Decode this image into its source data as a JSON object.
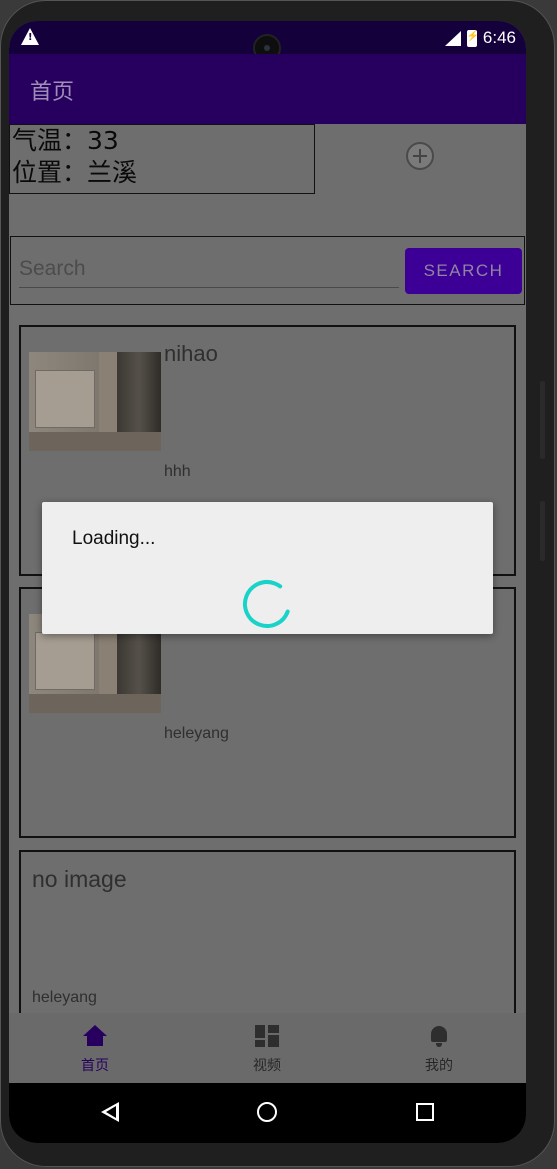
{
  "status_bar": {
    "time": "6:46",
    "warning_icon": "warning-icon",
    "signal_icon": "signal-icon",
    "battery_icon": "battery-charging-icon"
  },
  "app_bar": {
    "title": "首页"
  },
  "weather": {
    "temperature": "气温：33",
    "location": "位置：兰溪"
  },
  "add_button": {
    "icon": "add-circle-icon"
  },
  "search": {
    "placeholder": "Search",
    "button_label": "SEARCH"
  },
  "cards": [
    {
      "title": "nihao",
      "subtitle": "hhh",
      "has_image": true
    },
    {
      "title": "",
      "subtitle": "heleyang",
      "has_image": true
    },
    {
      "title": "no image",
      "subtitle": "heleyang",
      "has_image": false
    }
  ],
  "bottom_nav": {
    "items": [
      {
        "label": "首页",
        "icon": "home-icon",
        "active": true
      },
      {
        "label": "视频",
        "icon": "dashboard-icon",
        "active": false
      },
      {
        "label": "我的",
        "icon": "bell-icon",
        "active": false
      }
    ]
  },
  "dialog": {
    "message": "Loading..."
  },
  "colors": {
    "primary": "#27005f",
    "status_bar": "#14003a",
    "accent_spinner": "#19d3c8",
    "search_button": "#3c0096"
  }
}
